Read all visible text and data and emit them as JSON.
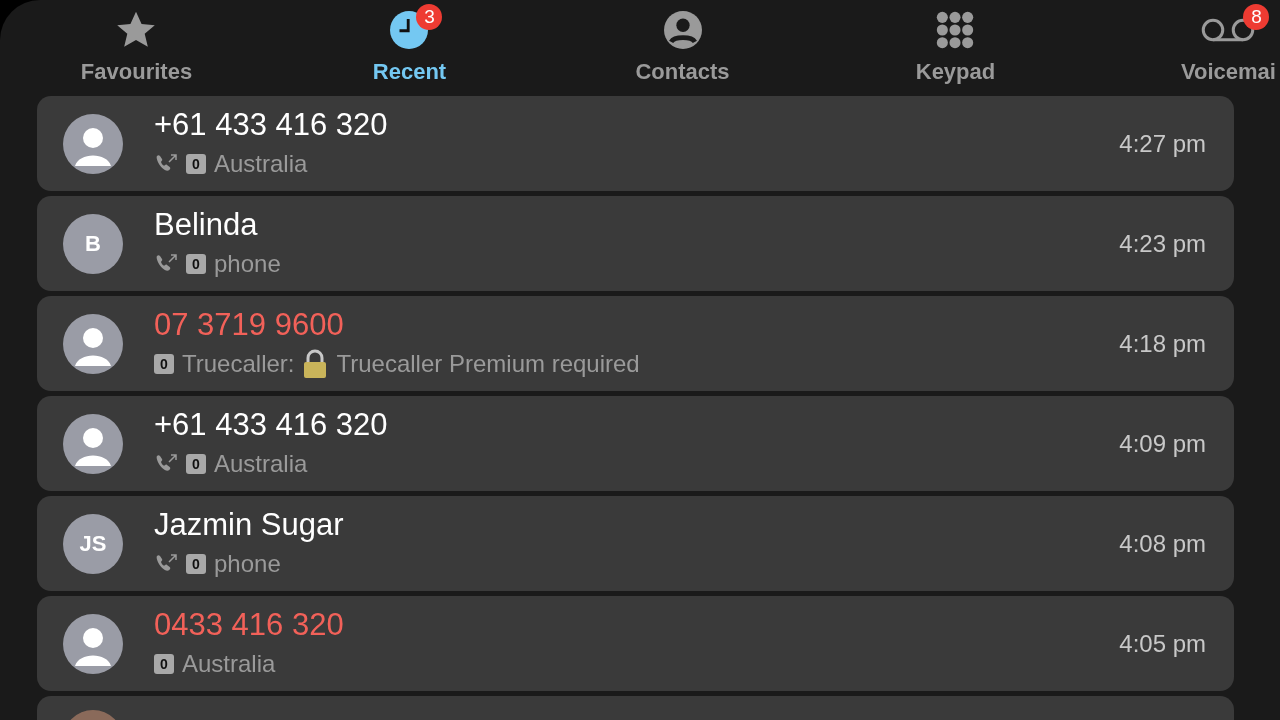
{
  "tabs": [
    {
      "kind": "star",
      "label": "Favourites",
      "selected": false
    },
    {
      "kind": "clock",
      "label": "Recent",
      "selected": true,
      "badge": "3"
    },
    {
      "kind": "person",
      "label": "Contacts",
      "selected": false
    },
    {
      "kind": "keypad",
      "label": "Keypad",
      "selected": false
    },
    {
      "kind": "voicemail",
      "label": "Voicemai",
      "selected": false,
      "badge": "8"
    }
  ],
  "calls": [
    {
      "avatar": {
        "kind": "silhouette"
      },
      "name": "+61 433 416 320",
      "missed": false,
      "call_icon": true,
      "sim": "0",
      "detail": "Australia",
      "time": "4:27 pm"
    },
    {
      "avatar": {
        "kind": "initials",
        "initials": "B"
      },
      "name": "Belinda",
      "missed": false,
      "call_icon": true,
      "sim": "0",
      "detail": "phone",
      "time": "4:23 pm"
    },
    {
      "avatar": {
        "kind": "silhouette"
      },
      "name": "07 3719 9600",
      "missed": true,
      "call_icon": false,
      "sim": "0",
      "prefix": "Truecaller:",
      "lock": true,
      "detail": "Truecaller Premium required",
      "time": "4:18 pm"
    },
    {
      "avatar": {
        "kind": "silhouette"
      },
      "name": "+61 433 416 320",
      "missed": false,
      "call_icon": true,
      "sim": "0",
      "detail": "Australia",
      "time": "4:09 pm"
    },
    {
      "avatar": {
        "kind": "initials",
        "initials": "JS"
      },
      "name": "Jazmin Sugar",
      "missed": false,
      "call_icon": true,
      "sim": "0",
      "detail": "phone",
      "time": "4:08 pm"
    },
    {
      "avatar": {
        "kind": "silhouette"
      },
      "name": "0433 416 320",
      "missed": true,
      "call_icon": false,
      "sim": "0",
      "detail": "Australia",
      "time": "4:05 pm"
    },
    {
      "avatar": {
        "kind": "photo"
      }
    }
  ]
}
